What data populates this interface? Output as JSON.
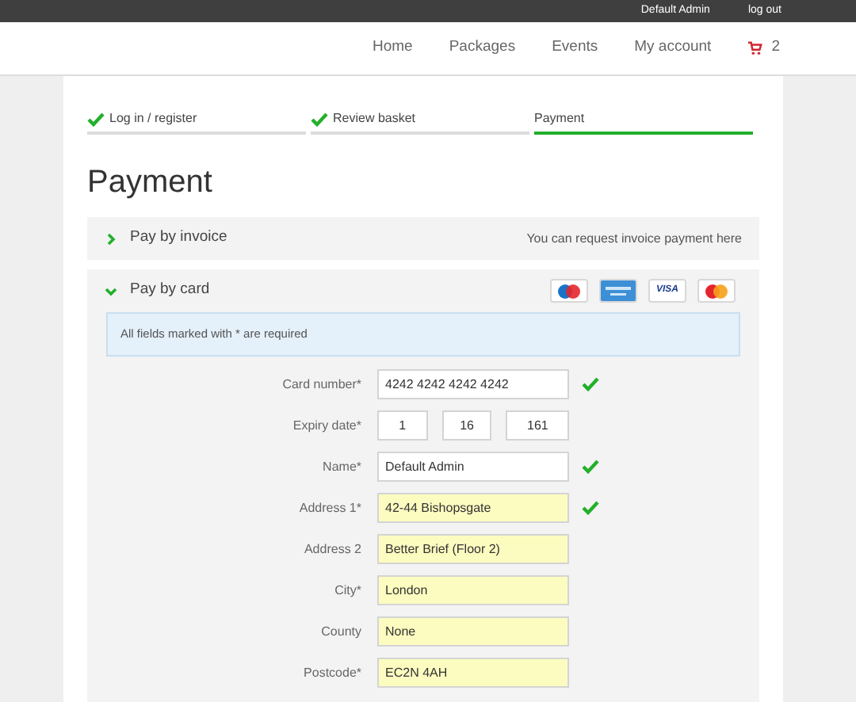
{
  "top_bar": {
    "user": "Default Admin",
    "logout": "log out"
  },
  "nav": {
    "items": [
      "Home",
      "Packages",
      "Events",
      "My account"
    ],
    "cart_count": "2"
  },
  "steps": [
    {
      "label": "Log in / register",
      "done": true,
      "selected": false
    },
    {
      "label": "Review basket",
      "done": true,
      "selected": false
    },
    {
      "label": "Payment",
      "done": false,
      "selected": true
    }
  ],
  "title": "Payment",
  "panels": [
    {
      "title": "Pay by invoice",
      "expanded": false,
      "note": "You can request invoice payment here"
    },
    {
      "title": "Pay by card",
      "expanded": true,
      "cards": [
        {
          "kind": "maestro"
        },
        {
          "kind": "amex"
        },
        {
          "kind": "visa",
          "text": "VISA"
        },
        {
          "kind": "mastercard"
        }
      ]
    }
  ],
  "notice": "All fields marked with * are required",
  "fields": [
    {
      "label": "Card number*",
      "values": [
        "4242 4242 4242 4242"
      ],
      "autofilled": false,
      "valid": true
    },
    {
      "label": "Expiry date*",
      "values": [
        "1",
        "16",
        "161"
      ],
      "autofilled": false,
      "valid": false
    },
    {
      "label": "Name*",
      "values": [
        "Default Admin"
      ],
      "autofilled": false,
      "valid": true
    },
    {
      "label": "Address 1*",
      "values": [
        "42-44 Bishopsgate"
      ],
      "autofilled": true,
      "valid": true
    },
    {
      "label": "Address 2",
      "values": [
        "Better Brief (Floor 2)"
      ],
      "autofilled": true,
      "valid": false
    },
    {
      "label": "City*",
      "values": [
        "London"
      ],
      "autofilled": true,
      "valid": false
    },
    {
      "label": "County",
      "values": [
        "None"
      ],
      "autofilled": true,
      "valid": false
    },
    {
      "label": "Postcode*",
      "values": [
        "EC2N 4AH"
      ],
      "autofilled": true,
      "valid": false
    }
  ]
}
